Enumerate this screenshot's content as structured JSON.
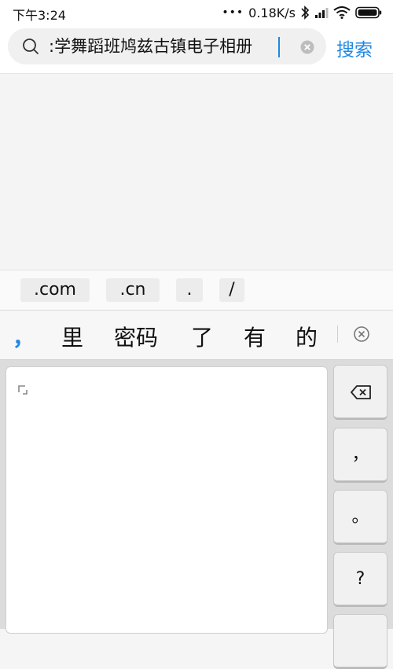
{
  "status_bar": {
    "time": "下午3:24",
    "dots": "•••",
    "network_speed": "0.18K/s"
  },
  "search": {
    "query": ":学舞蹈班鸠兹古镇电子相册",
    "button_label": "搜索"
  },
  "shortcuts": [
    ".com",
    ".cn",
    ".",
    "/"
  ],
  "candidates": [
    "，",
    "里",
    "密码",
    "了",
    "有",
    "的"
  ],
  "side_keys": [
    "，",
    "。",
    "?"
  ],
  "colors": {
    "accent": "#1e88e5",
    "search_box": "#f0f0f0",
    "keyboard_bg": "#dcdcdc"
  }
}
